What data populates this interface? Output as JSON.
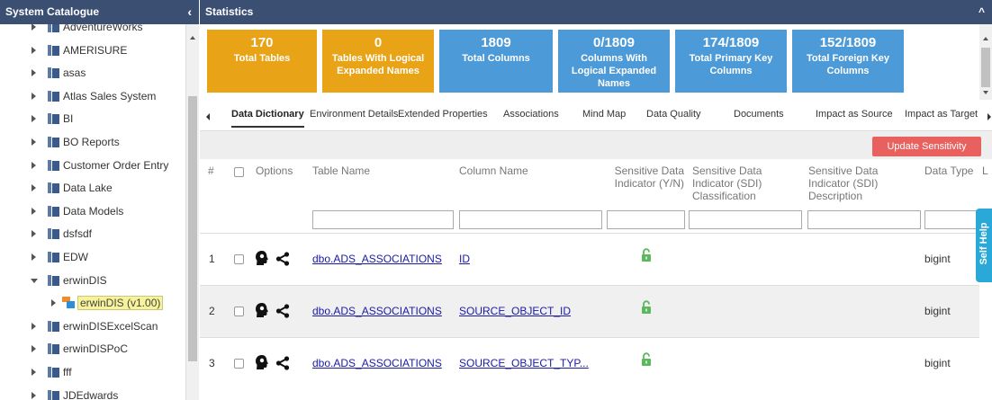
{
  "left_panel": {
    "title": "System Catalogue",
    "collapse_icon": "chevron-left-icon",
    "tree": [
      {
        "label": "AdventureWorks"
      },
      {
        "label": "AMERISURE"
      },
      {
        "label": "asas"
      },
      {
        "label": "Atlas Sales System"
      },
      {
        "label": "BI"
      },
      {
        "label": "BO Reports"
      },
      {
        "label": "Customer Order Entry"
      },
      {
        "label": "Data Lake"
      },
      {
        "label": "Data Models"
      },
      {
        "label": "dsfsdf"
      },
      {
        "label": "EDW"
      },
      {
        "label": "erwinDIS",
        "expanded": true
      },
      {
        "label": "erwinDIS (v1.00)",
        "selected": true
      },
      {
        "label": "erwinDISExcelScan"
      },
      {
        "label": "erwinDISPoC"
      },
      {
        "label": "fff"
      },
      {
        "label": "JDEdwards"
      }
    ]
  },
  "right_panel": {
    "title": "Statistics",
    "stats": [
      {
        "value": "170",
        "label": "Total Tables",
        "color": "#e8a317"
      },
      {
        "value": "0",
        "label": "Tables With Logical Expanded Names",
        "color": "#e8a317"
      },
      {
        "value": "1809",
        "label": "Total Columns",
        "color": "#4d9ad8"
      },
      {
        "value": "0/1809",
        "label": "Columns With Logical Expanded Names",
        "color": "#4d9ad8"
      },
      {
        "value": "174/1809",
        "label": "Total Primary Key Columns",
        "color": "#4d9ad8"
      },
      {
        "value": "152/1809",
        "label": "Total Foreign Key Columns",
        "color": "#4d9ad8"
      }
    ],
    "tabs": [
      {
        "label": "Data Dictionary",
        "active": true
      },
      {
        "label": "Environment Details"
      },
      {
        "label": "Extended Properties"
      },
      {
        "label": "Associations"
      },
      {
        "label": "Mind Map"
      },
      {
        "label": "Data Quality"
      },
      {
        "label": "Documents"
      },
      {
        "label": "Impact as Source"
      },
      {
        "label": "Impact as Target"
      }
    ],
    "update_button": "Update Sensitivity",
    "columns": {
      "num": "#",
      "options": "Options",
      "table_name": "Table Name",
      "column_name": "Column Name",
      "sdi_yn": "Sensitive Data Indicator (Y/N)",
      "sdi_class": "Sensitive Data Indicator (SDI) Classification",
      "sdi_desc": "Sensitive Data Indicator (SDI) Description",
      "data_type": "Data Type",
      "more": "L"
    },
    "rows": [
      {
        "num": "1",
        "table": "dbo.ADS_ASSOCIATIONS",
        "column": "ID",
        "data_type": "bigint"
      },
      {
        "num": "2",
        "table": "dbo.ADS_ASSOCIATIONS",
        "column": "SOURCE_OBJECT_ID",
        "data_type": "bigint"
      },
      {
        "num": "3",
        "table": "dbo.ADS_ASSOCIATIONS",
        "column": "SOURCE_OBJECT_TYP...",
        "data_type": "bigint"
      }
    ]
  },
  "self_help": "Self Help",
  "colors": {
    "header": "#3b4f73",
    "orange": "#e8a317",
    "blue": "#4d9ad8",
    "update": "#e8615e",
    "self_help": "#2aa8d8",
    "lock": "#5cb85c"
  }
}
